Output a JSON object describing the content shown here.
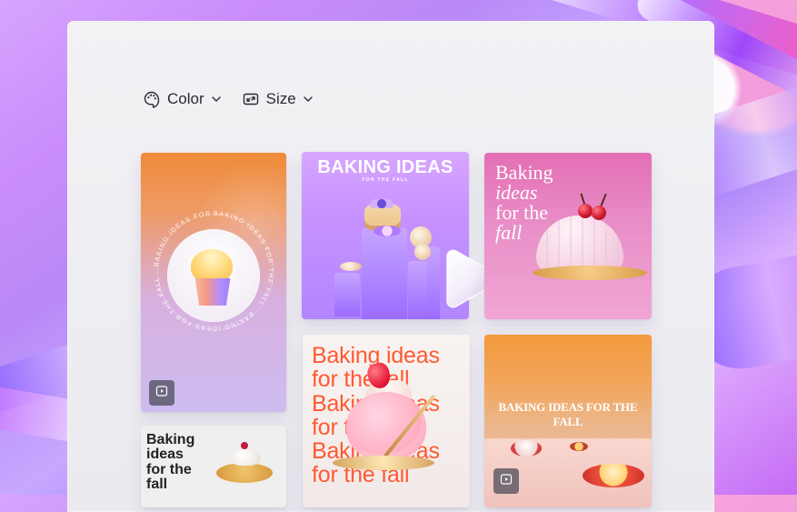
{
  "toolbar": {
    "color_label": "Color",
    "size_label": "Size"
  },
  "tiles": {
    "tile1": {
      "arc_text": "BAKING IDEAS FOR THE FALL · BAKING IDEAS FOR THE FALL · BAKING IDEAS FOR THE FALL"
    },
    "tile2": {
      "title": "BAKING IDEAS",
      "subtitle": "FOR THE FALL"
    },
    "tile3": {
      "line1": "Baking",
      "line2": "ideas",
      "line3": "for the",
      "line4": "fall"
    },
    "tile4": {
      "line1": "Baking",
      "line2": "ideas",
      "line3": "for the",
      "line4": "fall"
    },
    "tile5": {
      "lines": [
        "Baking ideas",
        "for the fall",
        "Baking ideas",
        "for the fall",
        "Baking ideas",
        "for the fall"
      ]
    },
    "tile6": {
      "title": "BAKING IDEAS FOR THE FALL"
    }
  },
  "icons": {
    "color": "palette-icon",
    "size": "resize-icon",
    "chevron": "chevron-down-icon",
    "video": "video-icon",
    "play": "play-icon"
  },
  "colors": {
    "panel": "#f1f0f4",
    "accent_orange": "#ff5a31",
    "accent_purple": "#b286ff",
    "accent_pink": "#e36eb4"
  }
}
